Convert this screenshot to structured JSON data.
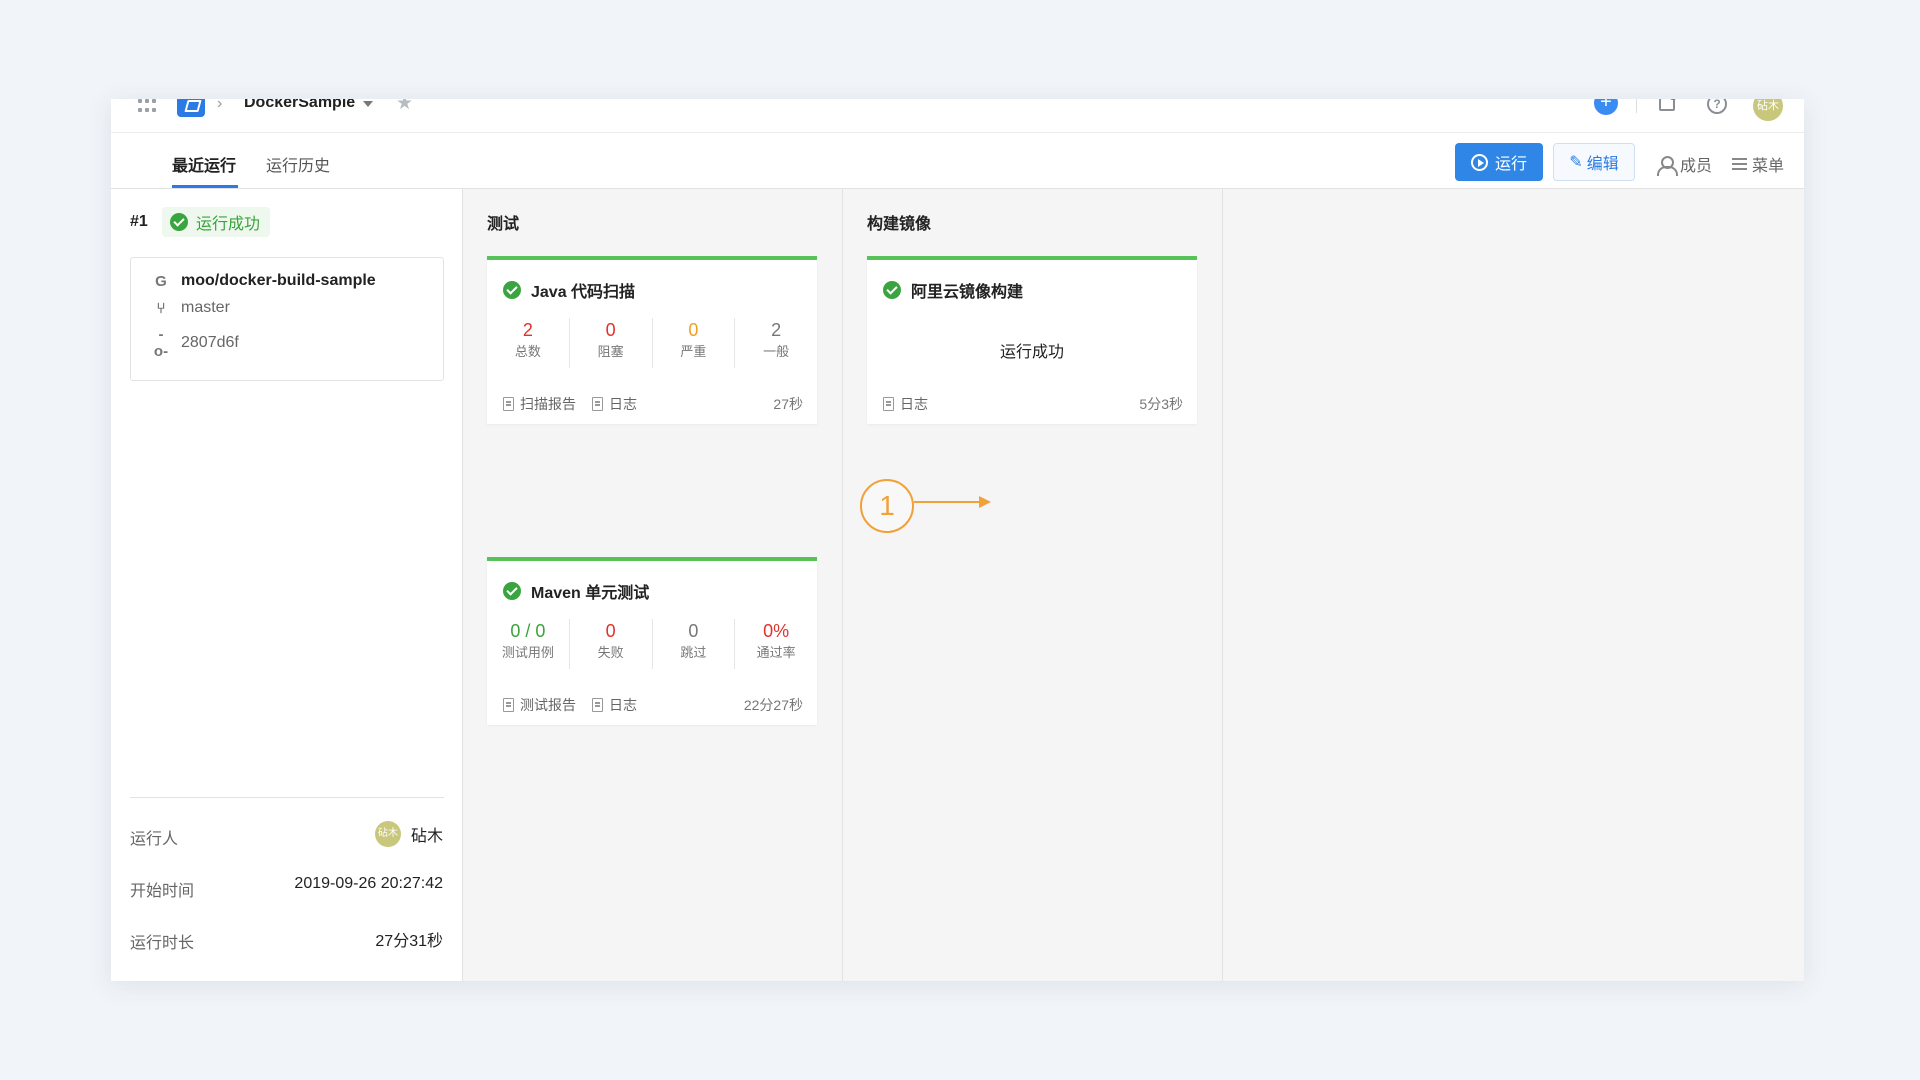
{
  "header": {
    "project_name": "DockerSample",
    "icons": [
      "apps-icon",
      "logo-icon",
      "chevron-right-icon",
      "caret-down-icon",
      "star-icon",
      "add-icon",
      "bell-icon",
      "help-icon"
    ],
    "user_avatar": "砧木"
  },
  "tabs": [
    {
      "label": "最近运行",
      "active": true
    },
    {
      "label": "运行历史",
      "active": false
    }
  ],
  "actions": {
    "run_label": "运行",
    "edit_label": "编辑",
    "members_label": "成员",
    "menu_label": "菜单"
  },
  "run": {
    "number": "#1",
    "status": "运行成功",
    "repo": "moo/docker-build-sample",
    "branch": "master",
    "commit": "2807d6f",
    "runner_label": "运行人",
    "runner_avatar": "砧木",
    "runner_name": "砧木",
    "start_label": "开始时间",
    "start_time": "2019-09-26 20:27:42",
    "duration_label": "运行时长",
    "duration": "27分31秒"
  },
  "stages": [
    {
      "title": "测试",
      "jobs": [
        {
          "name": "Java 代码扫描",
          "stats": [
            {
              "value": "2",
              "label": "总数",
              "color": "#e0322b"
            },
            {
              "value": "0",
              "label": "阻塞",
              "color": "#e0322b"
            },
            {
              "value": "0",
              "label": "严重",
              "color": "#f0a020"
            },
            {
              "value": "2",
              "label": "一般",
              "color": "#777777"
            }
          ],
          "links": [
            "扫描报告",
            "日志"
          ],
          "time": "27秒"
        },
        {
          "name": "Maven 单元测试",
          "stats": [
            {
              "value": "0 / 0",
              "label": "测试用例",
              "color": "#3aa33a"
            },
            {
              "value": "0",
              "label": "失败",
              "color": "#e0322b"
            },
            {
              "value": "0",
              "label": "跳过",
              "color": "#777777"
            },
            {
              "value": "0%",
              "label": "通过率",
              "color": "#e0322b"
            }
          ],
          "links": [
            "测试报告",
            "日志"
          ],
          "time": "22分27秒"
        }
      ]
    },
    {
      "title": "构建镜像",
      "jobs": [
        {
          "name": "阿里云镜像构建",
          "center_text": "运行成功",
          "links": [
            "日志"
          ],
          "time": "5分3秒"
        }
      ]
    }
  ],
  "annotation": {
    "label": "1",
    "color": "#f0a13a"
  },
  "colors": {
    "accent": "#2c7be5",
    "success": "#3aa540",
    "error": "#e0322b",
    "warning": "#f0a020"
  }
}
